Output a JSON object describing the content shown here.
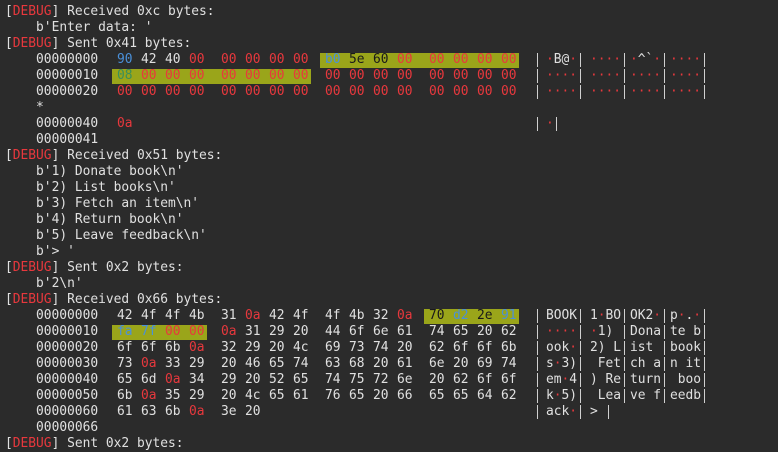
{
  "lines": [
    {
      "kind": "debug",
      "text": " Received 0xc bytes:"
    },
    {
      "kind": "text",
      "text": "    b'Enter data: '"
    },
    {
      "kind": "debug",
      "text": " Sent 0x41 bytes:"
    },
    {
      "kind": "hex",
      "offset": "00000000",
      "bytes": [
        "90",
        "42",
        "40",
        "00",
        "00",
        "00",
        "00",
        "00",
        "b0",
        "5e",
        "60",
        "00",
        "00",
        "00",
        "00",
        "00"
      ],
      "ascii": [
        "·B@·",
        "····",
        "·^`·",
        "····"
      ],
      "hl": [
        8,
        15
      ]
    },
    {
      "kind": "hex",
      "offset": "00000010",
      "bytes": [
        "08",
        "00",
        "00",
        "00",
        "00",
        "00",
        "00",
        "00",
        "00",
        "00",
        "00",
        "00",
        "00",
        "00",
        "00",
        "00"
      ],
      "ascii": [
        "····",
        "····",
        "····",
        "····"
      ],
      "hl": [
        0,
        7
      ]
    },
    {
      "kind": "hex",
      "offset": "00000020",
      "bytes": [
        "00",
        "00",
        "00",
        "00",
        "00",
        "00",
        "00",
        "00",
        "00",
        "00",
        "00",
        "00",
        "00",
        "00",
        "00",
        "00"
      ],
      "ascii": [
        "····",
        "····",
        "····",
        "····"
      ],
      "hl": null
    },
    {
      "kind": "text",
      "text": "    *"
    },
    {
      "kind": "hex",
      "offset": "00000040",
      "bytes": [
        "0a"
      ],
      "ascii": [
        "·"
      ],
      "hl": null
    },
    {
      "kind": "text",
      "text": "    00000041"
    },
    {
      "kind": "debug",
      "text": " Received 0x51 bytes:"
    },
    {
      "kind": "text",
      "text": "    b'1) Donate book\\n'"
    },
    {
      "kind": "text",
      "text": "    b'2) List books\\n'"
    },
    {
      "kind": "text",
      "text": "    b'3) Fetch an item\\n'"
    },
    {
      "kind": "text",
      "text": "    b'4) Return book\\n'"
    },
    {
      "kind": "text",
      "text": "    b'5) Leave feedback\\n'"
    },
    {
      "kind": "text",
      "text": "    b'> '"
    },
    {
      "kind": "debug",
      "text": " Sent 0x2 bytes:"
    },
    {
      "kind": "text",
      "text": "    b'2\\n'"
    },
    {
      "kind": "debug",
      "text": " Received 0x66 bytes:"
    },
    {
      "kind": "hex",
      "offset": "00000000",
      "bytes": [
        "42",
        "4f",
        "4f",
        "4b",
        "31",
        "0a",
        "42",
        "4f",
        "4f",
        "4b",
        "32",
        "0a",
        "70",
        "d2",
        "2e",
        "91"
      ],
      "ascii": [
        "BOOK",
        "1·BO",
        "OK2·",
        "p·.·"
      ],
      "hl": [
        12,
        15
      ]
    },
    {
      "kind": "hex",
      "offset": "00000010",
      "bytes": [
        "fa",
        "7f",
        "00",
        "00",
        "0a",
        "31",
        "29",
        "20",
        "44",
        "6f",
        "6e",
        "61",
        "74",
        "65",
        "20",
        "62"
      ],
      "ascii": [
        "····",
        "·1) ",
        "Dona",
        "te b"
      ],
      "hl": [
        0,
        3
      ]
    },
    {
      "kind": "hex",
      "offset": "00000020",
      "bytes": [
        "6f",
        "6f",
        "6b",
        "0a",
        "32",
        "29",
        "20",
        "4c",
        "69",
        "73",
        "74",
        "20",
        "62",
        "6f",
        "6f",
        "6b"
      ],
      "ascii": [
        "ook·",
        "2) L",
        "ist ",
        "book"
      ],
      "hl": null
    },
    {
      "kind": "hex",
      "offset": "00000030",
      "bytes": [
        "73",
        "0a",
        "33",
        "29",
        "20",
        "46",
        "65",
        "74",
        "63",
        "68",
        "20",
        "61",
        "6e",
        "20",
        "69",
        "74"
      ],
      "ascii": [
        "s·3)",
        " Fet",
        "ch a",
        "n it"
      ],
      "hl": null
    },
    {
      "kind": "hex",
      "offset": "00000040",
      "bytes": [
        "65",
        "6d",
        "0a",
        "34",
        "29",
        "20",
        "52",
        "65",
        "74",
        "75",
        "72",
        "6e",
        "20",
        "62",
        "6f",
        "6f"
      ],
      "ascii": [
        "em·4",
        ") Re",
        "turn",
        " boo"
      ],
      "hl": null
    },
    {
      "kind": "hex",
      "offset": "00000050",
      "bytes": [
        "6b",
        "0a",
        "35",
        "29",
        "20",
        "4c",
        "65",
        "61",
        "76",
        "65",
        "20",
        "66",
        "65",
        "65",
        "64",
        "62"
      ],
      "ascii": [
        "k·5)",
        " Lea",
        "ve f",
        "eedb"
      ],
      "hl": null
    },
    {
      "kind": "hex",
      "offset": "00000060",
      "bytes": [
        "61",
        "63",
        "6b",
        "0a",
        "3e",
        "20"
      ],
      "ascii": [
        "ack·",
        "> "
      ],
      "hl": null
    },
    {
      "kind": "text",
      "text": "    00000066"
    },
    {
      "kind": "debug",
      "text": " Sent 0x2 bytes:"
    }
  ],
  "debug_label": "DEBUG",
  "colors": {
    "background": "#2b2b2b",
    "text": "#e0e0e0",
    "red": "#e8383d",
    "highlight": "#9aa51a",
    "green": "#6aa84f",
    "blue": "#4a90d9"
  }
}
